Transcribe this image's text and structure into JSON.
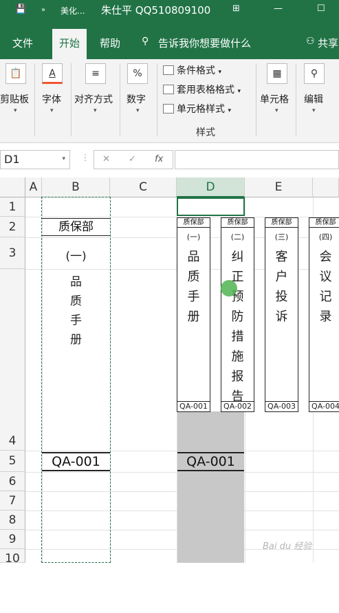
{
  "titlebar": {
    "save_icon": "💾",
    "more_icon": "»",
    "doc_name": "美化...",
    "user": "朱仕平 QQ510809100",
    "layout_icon": "⊞",
    "minimize": "—",
    "maximize": "☐"
  },
  "tabs": {
    "file": "文件",
    "home": "开始",
    "help": "帮助",
    "tell_me": "告诉我你想要做什么",
    "share": "共享"
  },
  "ribbon": {
    "clipboard": "剪贴板",
    "font": "字体",
    "alignment": "对齐方式",
    "number": "数字",
    "conditional_format": "条件格式",
    "format_as_table": "套用表格格式",
    "cell_styles": "单元格样式",
    "styles_group": "样式",
    "cells": "单元格",
    "editing": "编辑",
    "dropdown": "▾"
  },
  "formula_bar": {
    "name_box": "D1",
    "cancel": "✕",
    "enter": "✓",
    "fx": "fx",
    "content": ""
  },
  "columns": [
    "A",
    "B",
    "C",
    "D",
    "E"
  ],
  "rows": [
    "1",
    "2",
    "3",
    "4",
    "5",
    "6",
    "7",
    "8",
    "9",
    "10"
  ],
  "cells": {
    "b_header": "质保部",
    "b_number": "(一)",
    "b_title": [
      "品",
      "质",
      "手",
      "册"
    ],
    "b5": "QA-001",
    "d5": "QA-001"
  },
  "labels": [
    {
      "header": "质保部",
      "number": "(一)",
      "title": [
        "品",
        "质",
        "手",
        "册"
      ],
      "code": "QA-001"
    },
    {
      "header": "质保部",
      "number": "(二)",
      "title": [
        "纠",
        "正",
        "预",
        "防",
        "措",
        "施",
        "报",
        "告"
      ],
      "code": "QA-002"
    },
    {
      "header": "质保部",
      "number": "(三)",
      "title": [
        "客",
        "户",
        "投",
        "诉"
      ],
      "code": "QA-003"
    },
    {
      "header": "质保部",
      "number": "(四)",
      "title": [
        "会",
        "议",
        "记",
        "录"
      ],
      "code": "QA-004"
    }
  ],
  "watermark": "Bai du 经验",
  "colors": {
    "excel_green": "#217346",
    "selection_gray": "#c8c8c8"
  }
}
